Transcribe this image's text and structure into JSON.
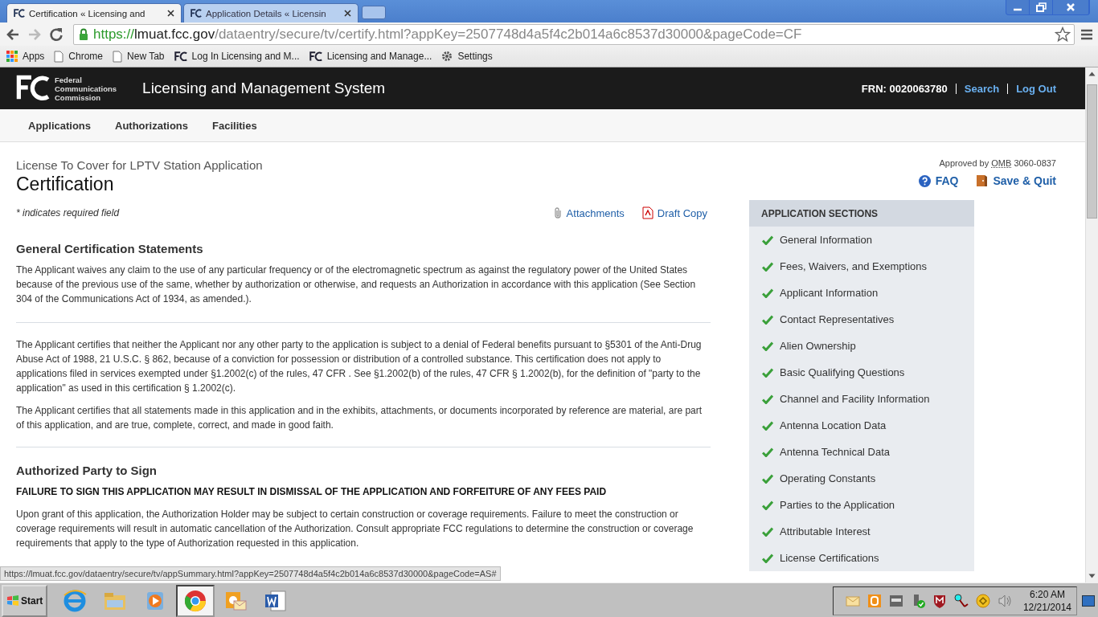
{
  "browser": {
    "tabs": [
      {
        "title": "Certification « Licensing and",
        "selected": true
      },
      {
        "title": "Application Details « Licensin",
        "selected": false
      }
    ],
    "url": {
      "scheme": "https://",
      "host": "lmuat.fcc.gov",
      "path": "/dataentry/secure/tv/certify.html?appKey=2507748d4a5f4c2b014a6c8537d30000&pageCode=CF"
    },
    "bookmarks": [
      {
        "kind": "apps",
        "label": "Apps"
      },
      {
        "kind": "page",
        "label": "Chrome"
      },
      {
        "kind": "page",
        "label": "New Tab"
      },
      {
        "kind": "fcc",
        "label": "Log In Licensing and M..."
      },
      {
        "kind": "fcc",
        "label": "Licensing and Manage..."
      },
      {
        "kind": "gear",
        "label": "Settings"
      }
    ]
  },
  "header": {
    "agency": [
      "Federal",
      "Communications",
      "Commission"
    ],
    "title": "Licensing and Management System",
    "frn": "FRN: 0020063780",
    "links": [
      "Search",
      "Log Out"
    ]
  },
  "nav": [
    "Applications",
    "Authorizations",
    "Facilities"
  ],
  "page": {
    "subtitle": "License To Cover for LPTV Station Application",
    "title": "Certification",
    "omb_prefix": "Approved by",
    "omb_abbr": "OMB",
    "omb_number": "3060-0837",
    "faq": "FAQ",
    "save_quit": "Save & Quit",
    "required_note": "* indicates required field",
    "attachments": "Attachments",
    "draft_copy": "Draft Copy"
  },
  "sections": [
    {
      "heading": "General Certification Statements",
      "blocks": [
        {
          "kind": "text",
          "text": "The Applicant waives any claim to the use of any particular frequency or of the electromagnetic spectrum as against the regulatory power of the United States because of the previous use of the same, whether by authorization or otherwise, and requests an Authorization in accordance with this application (See Section 304 of the Communications Act of 1934, as amended.)."
        },
        {
          "kind": "rule"
        },
        {
          "kind": "text",
          "text": "The Applicant certifies that neither the Applicant nor any other party to the application is subject to a denial of Federal benefits pursuant to §5301 of the Anti-Drug Abuse Act of 1988, 21 U.S.C. § 862, because of a conviction for possession or distribution of a controlled substance. This certification does not apply to applications filed in services exempted under §1.2002(c) of the rules, 47 CFR . See §1.2002(b) of the rules, 47 CFR § 1.2002(b), for the definition of \"party to the application\" as used in this certification § 1.2002(c)."
        },
        {
          "kind": "text",
          "text": "The Applicant certifies that all statements made in this application and in the exhibits, attachments, or documents incorporated by reference are material, are part of this application, and are true, complete, correct, and made in good faith."
        }
      ]
    },
    {
      "heading": "Authorized Party to Sign",
      "blocks": [
        {
          "kind": "warning",
          "text": "FAILURE TO SIGN THIS APPLICATION MAY RESULT IN DISMISSAL OF THE APPLICATION AND FORFEITURE OF ANY FEES PAID"
        },
        {
          "kind": "text",
          "text": "Upon grant of this application, the Authorization Holder may be subject to certain construction or coverage requirements. Failure to meet the construction or coverage requirements will result in automatic cancellation of the Authorization. Consult appropriate FCC regulations to determine the construction or coverage requirements that apply to the type of Authorization requested in this application."
        }
      ]
    }
  ],
  "sidebar": {
    "title": "APPLICATION SECTIONS",
    "items": [
      {
        "label": "General Information",
        "complete": true
      },
      {
        "label": "Fees, Waivers, and Exemptions",
        "complete": true
      },
      {
        "label": "Applicant Information",
        "complete": true
      },
      {
        "label": "Contact Representatives",
        "complete": true
      },
      {
        "label": "Alien Ownership",
        "complete": true
      },
      {
        "label": "Basic Qualifying Questions",
        "complete": true
      },
      {
        "label": "Channel and Facility Information",
        "complete": true
      },
      {
        "label": "Antenna Location Data",
        "complete": true
      },
      {
        "label": "Antenna Technical Data",
        "complete": true
      },
      {
        "label": "Operating Constants",
        "complete": true
      },
      {
        "label": "Parties to the Application",
        "complete": true
      },
      {
        "label": "Attributable Interest",
        "complete": true
      },
      {
        "label": "License Certifications",
        "complete": true
      }
    ]
  },
  "status_url": "https://lmuat.fcc.gov/dataentry/secure/tv/appSummary.html?appKey=2507748d4a5f4c2b014a6c8537d30000&pageCode=AS#",
  "taskbar": {
    "start": "Start",
    "apps": [
      {
        "kind": "ie",
        "selected": false
      },
      {
        "kind": "explorer",
        "selected": false
      },
      {
        "kind": "media",
        "selected": false
      },
      {
        "kind": "chrome",
        "selected": true
      },
      {
        "kind": "outlook",
        "selected": false
      },
      {
        "kind": "word",
        "selected": false
      }
    ],
    "tray": [
      {
        "kind": "mail"
      },
      {
        "kind": "office"
      },
      {
        "kind": "vm"
      },
      {
        "kind": "usb"
      },
      {
        "kind": "shield"
      },
      {
        "kind": "network"
      },
      {
        "kind": "sync"
      },
      {
        "kind": "volume"
      }
    ],
    "time": "6:20 AM",
    "date": "12/21/2014"
  }
}
